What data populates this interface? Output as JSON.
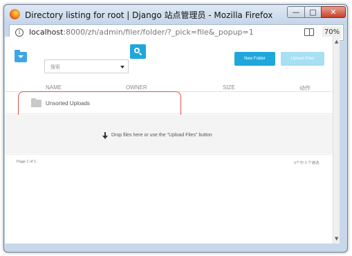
{
  "window": {
    "title": "Directory listing for root | Django 站点管理员 - Mozilla Firefox",
    "minimize_glyph": "—",
    "maximize_glyph": "□",
    "close_glyph": "✕"
  },
  "address_bar": {
    "host": "localhost",
    "path": ":8000/zh/admin/filer/folder/?_pick=file&_popup=1",
    "zoom": "70%"
  },
  "toolbar": {
    "search_placeholder": "搜索",
    "new_folder_label": "New Folder",
    "upload_files_label": "Upload Files"
  },
  "table": {
    "columns": [
      "NAME",
      "OWNER",
      "SIZE",
      "动作"
    ],
    "rows": [
      {
        "name": "Unsorted Uploads"
      }
    ]
  },
  "dropzone": {
    "text": "Drop files here or use the \"Upload Files\" button"
  },
  "footer": {
    "page_info": "Page 1 of 1.",
    "selected_info": "0个中 0 个被选"
  },
  "icons": {
    "browser": "firefox-icon",
    "info": "info-icon",
    "reader": "reader-view-icon",
    "folder_menu": "folder-dropdown-icon",
    "search": "search-icon",
    "row_folder": "folder-icon",
    "drop": "arrow-down-icon"
  },
  "colors": {
    "primary_button": "#1fa7dc",
    "disabled_button": "#a7dff3",
    "highlight_border": "#d9534f"
  }
}
